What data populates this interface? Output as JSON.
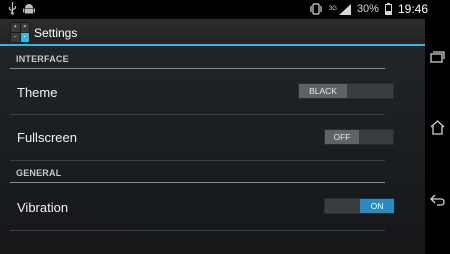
{
  "status_bar": {
    "battery": "30%",
    "time": "19:46",
    "network": "3G"
  },
  "action_bar": {
    "title": "Settings",
    "icon_glyphs": [
      "+",
      "×",
      "−",
      "÷"
    ]
  },
  "sections": [
    {
      "header": "INTERFACE",
      "prefs": [
        {
          "label": "Theme",
          "value": "BLACK"
        },
        {
          "label": "Fullscreen",
          "value": "OFF"
        }
      ]
    },
    {
      "header": "GENERAL",
      "prefs": [
        {
          "label": "Vibration",
          "value": "ON"
        }
      ]
    }
  ],
  "colors": {
    "accent": "#33b5e5",
    "toggle_on": "#2a8bc4",
    "toggle_off": "#5f6266"
  }
}
